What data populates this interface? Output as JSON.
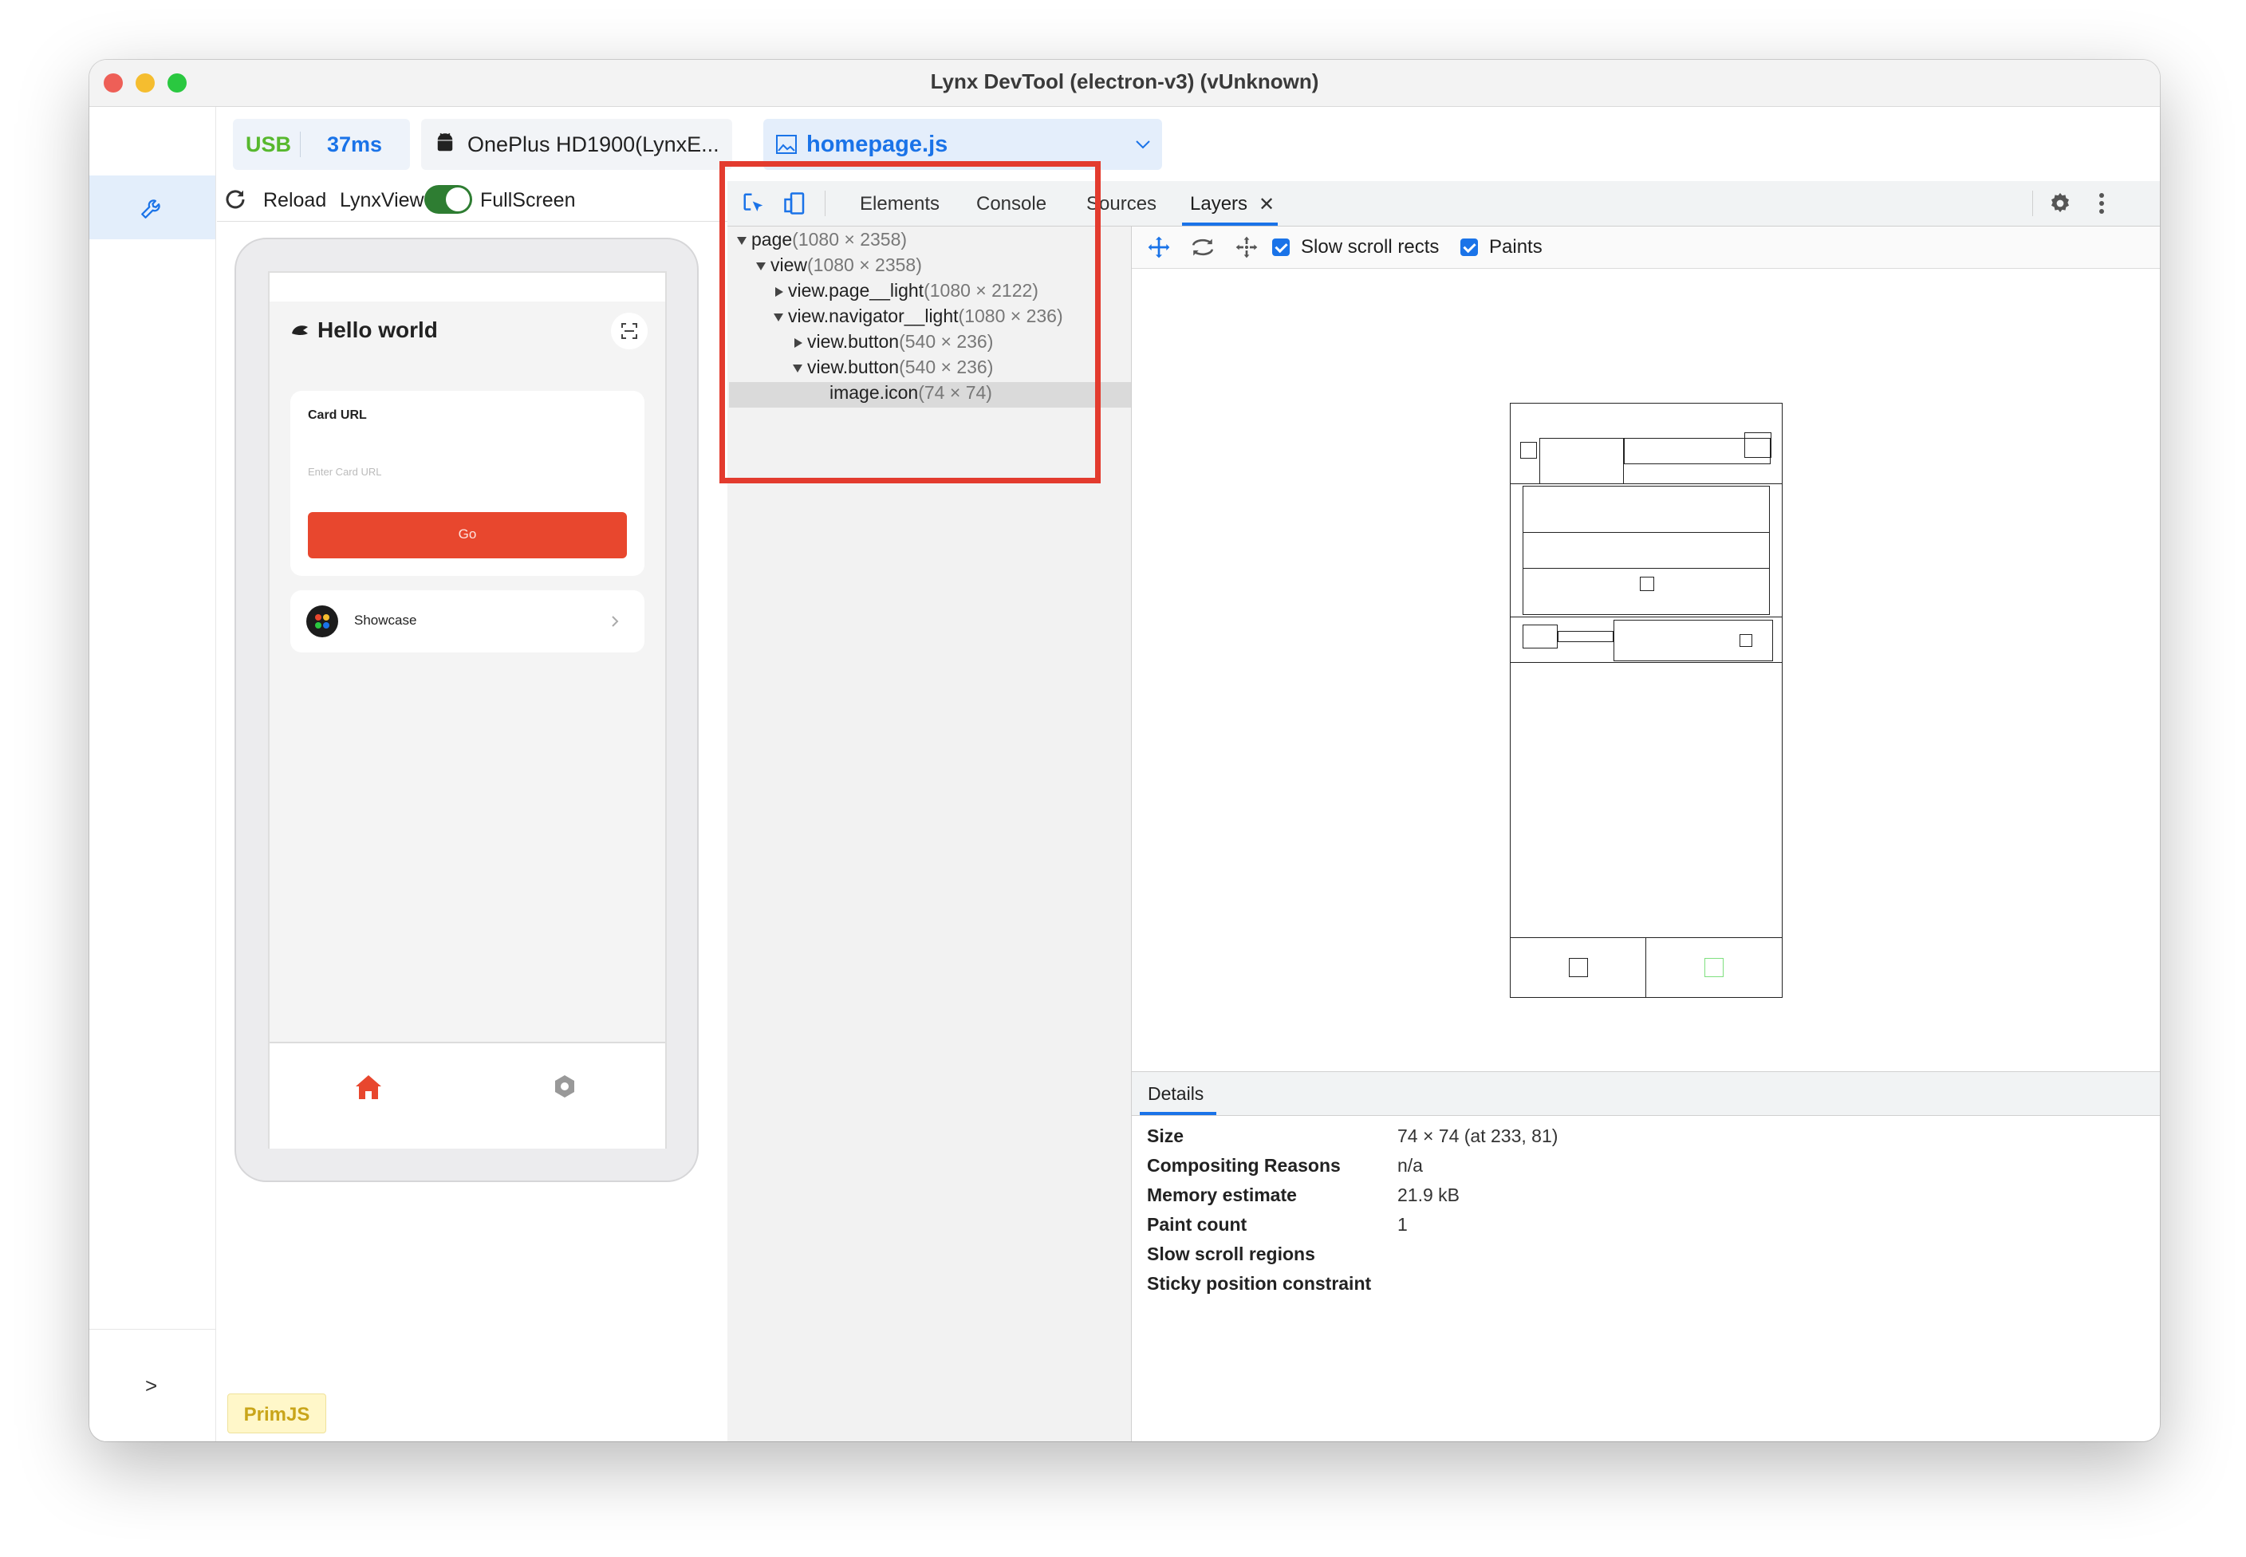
{
  "window": {
    "title": "Lynx DevTool (electron-v3) (vUnknown)"
  },
  "connection": {
    "usb_label": "USB",
    "latency": "37ms",
    "device": "OnePlus HD1900(LynxE...",
    "page_file": "homepage.js"
  },
  "preview_toolbar": {
    "reload": "Reload",
    "lynxview": "LynxView",
    "fullscreen": "FullScreen"
  },
  "phone": {
    "title": "Hello world",
    "card_url_label": "Card URL",
    "card_url_placeholder": "Enter Card URL",
    "go_button": "Go",
    "showcase_label": "Showcase"
  },
  "devtools_tabs": [
    "Elements",
    "Console",
    "Sources",
    "Layers"
  ],
  "layer_tree": [
    {
      "name": "page",
      "size": "(1080 × 2358)"
    },
    {
      "name": "view",
      "size": "(1080 × 2358)"
    },
    {
      "name": "view.page__light",
      "size": "(1080 × 2122)"
    },
    {
      "name": "view.navigator__light",
      "size": "(1080 × 236)"
    },
    {
      "name": "view.button",
      "size": "(540 × 236)"
    },
    {
      "name": "view.button",
      "size": "(540 × 236)"
    },
    {
      "name": "image.icon",
      "size": "(74 × 74)"
    }
  ],
  "layers_toolbar": {
    "slow_scroll_rects": "Slow scroll rects",
    "paints": "Paints"
  },
  "details": {
    "header": "Details",
    "rows": [
      {
        "key": "Size",
        "value": "74 × 74 (at 233, 81)"
      },
      {
        "key": "Compositing Reasons",
        "value": "n/a"
      },
      {
        "key": "Memory estimate",
        "value": "21.9 kB"
      },
      {
        "key": "Paint count",
        "value": "1"
      },
      {
        "key": "Slow scroll regions",
        "value": ""
      },
      {
        "key": "Sticky position constraint",
        "value": ""
      }
    ]
  },
  "footer": {
    "prompt": ">",
    "engine_badge": "PrimJS"
  },
  "colors": {
    "accent": "#1a73e8",
    "usb_green": "#57b82e",
    "go_red": "#e8472e",
    "highlight_red": "#e33b2e",
    "badge_yellow": "#fff7c9"
  }
}
